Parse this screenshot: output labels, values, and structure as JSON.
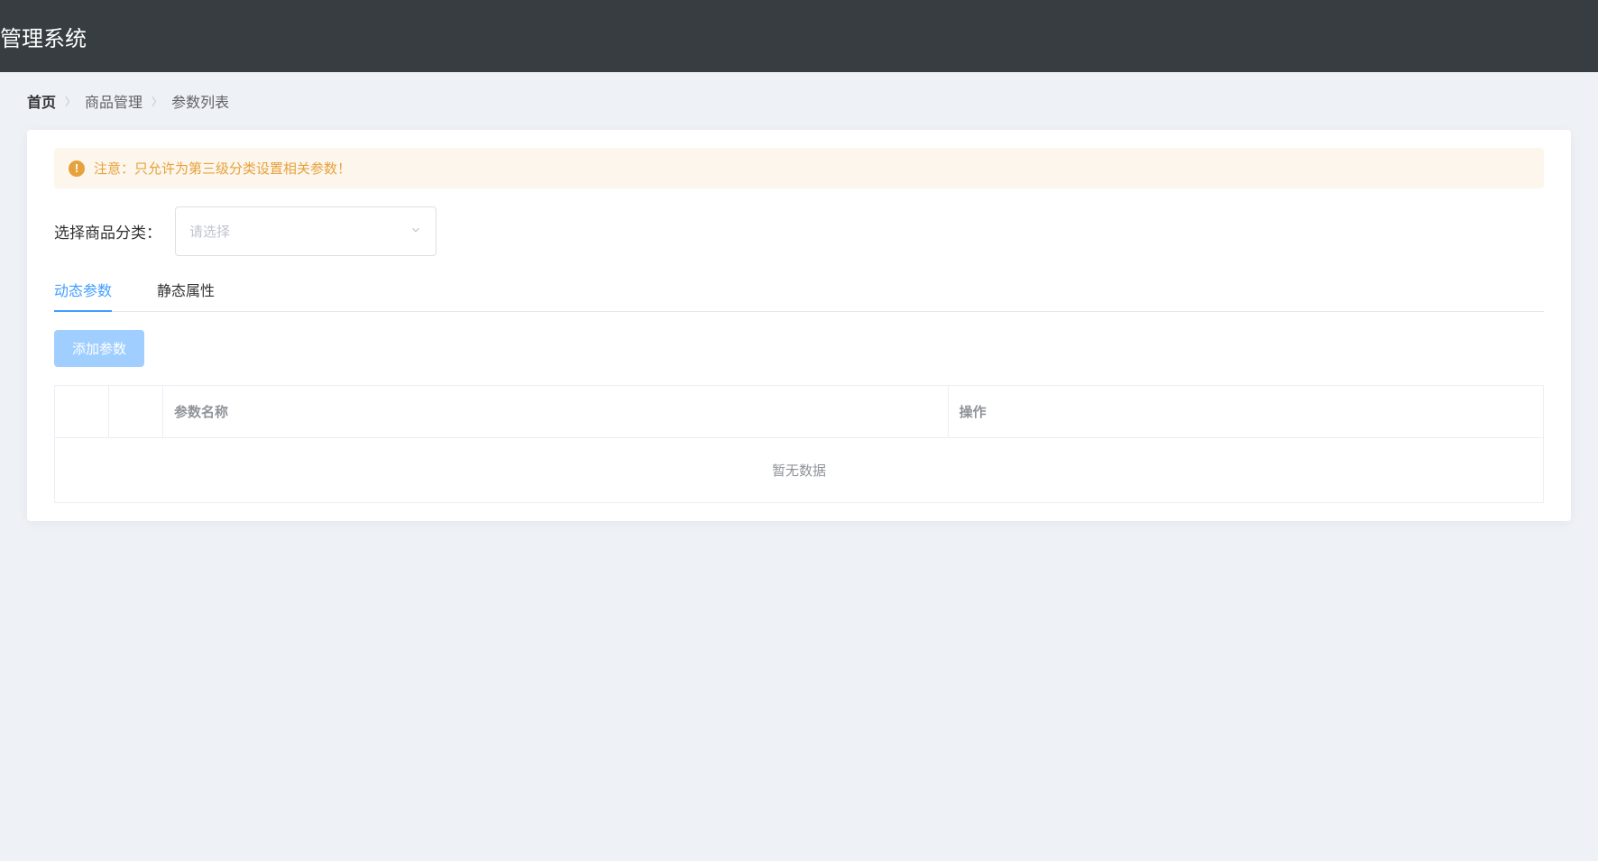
{
  "header": {
    "title": "管理系统"
  },
  "breadcrumb": {
    "items": [
      "首页",
      "商品管理",
      "参数列表"
    ]
  },
  "alert": {
    "text": "注意：只允许为第三级分类设置相关参数！"
  },
  "selector": {
    "label": "选择商品分类：",
    "placeholder": "请选择"
  },
  "tabs": {
    "items": [
      {
        "label": "动态参数",
        "active": true
      },
      {
        "label": "静态属性",
        "active": false
      }
    ]
  },
  "button": {
    "add_label": "添加参数"
  },
  "table": {
    "columns": {
      "name": "参数名称",
      "action": "操作"
    },
    "empty_text": "暂无数据"
  }
}
